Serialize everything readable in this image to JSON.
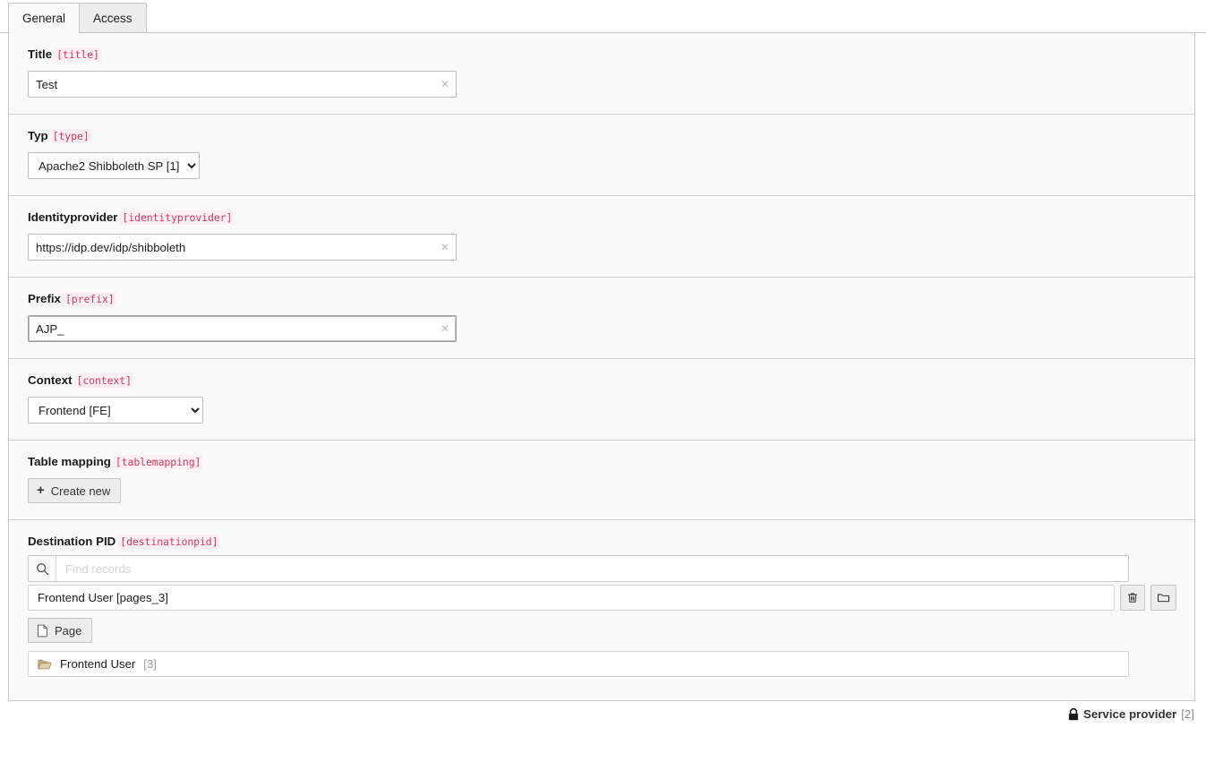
{
  "tabs": [
    {
      "label": "General",
      "active": true
    },
    {
      "label": "Access",
      "active": false
    }
  ],
  "fields": {
    "title": {
      "label": "Title",
      "code": "[title]",
      "value": "Test",
      "placeholder": "",
      "clear_icon": "close-x-icon"
    },
    "type": {
      "label": "Typ",
      "code": "[type]",
      "selected": "Apache2 Shibboleth SP [1]",
      "options": [
        "Apache2 Shibboleth SP [1]"
      ]
    },
    "identityprovider": {
      "label": "Identityprovider",
      "code": "[identityprovider]",
      "value": "https://idp.dev/idp/shibboleth",
      "placeholder": "",
      "clear_icon": "close-x-icon"
    },
    "prefix": {
      "label": "Prefix",
      "code": "[prefix]",
      "value": "AJP_",
      "placeholder": "",
      "focused": true,
      "clear_icon": "close-x-icon"
    },
    "context": {
      "label": "Context",
      "code": "[context]",
      "selected": "Frontend [FE]",
      "options": [
        "Frontend [FE]"
      ]
    },
    "tablemapping": {
      "label": "Table mapping",
      "code": "[tablemapping]",
      "create_button": "Create new",
      "create_icon": "plus-icon"
    },
    "destinationpid": {
      "label": "Destination PID",
      "code": "[destinationpid]",
      "search_placeholder": "Find records",
      "search_value": "",
      "search_icon": "search-icon",
      "selected_record": "Frontend User [pages_3]",
      "delete_icon": "trash-icon",
      "browse_icon": "folder-icon",
      "page_button": "Page",
      "page_icon": "page-icon",
      "records": [
        {
          "icon": "folder-open-icon",
          "label": "Frontend User",
          "uid": "[3]"
        }
      ]
    }
  },
  "footer": {
    "lock_icon": "lock-icon",
    "title": "Service provider",
    "uid": "[2]"
  },
  "colors": {
    "accent_code": "#d9365e",
    "code_bg": "#fdf0f4",
    "panel_bg": "#fafafa",
    "border": "#c8c8c8",
    "tab_inactive_bg": "#ededed"
  }
}
